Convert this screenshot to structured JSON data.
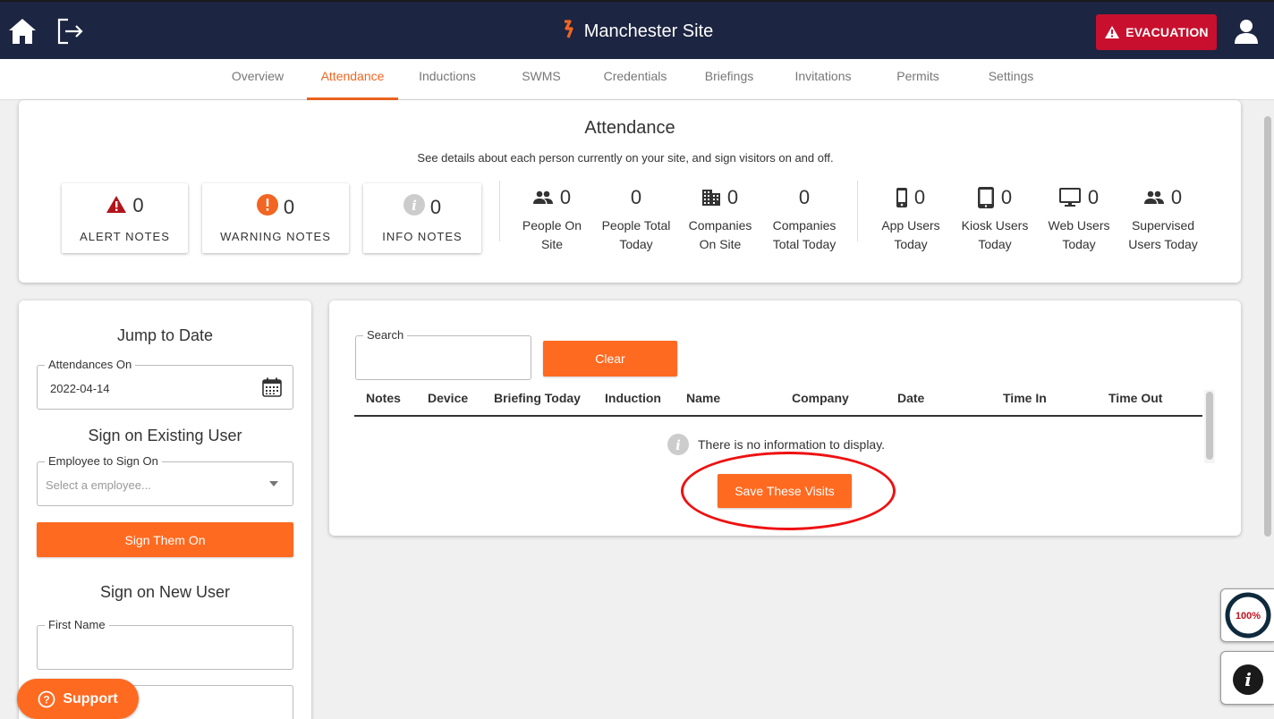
{
  "header": {
    "site_title": "Manchester Site",
    "evacuation_label": "EVACUATION"
  },
  "tabs": [
    {
      "label": "Overview",
      "active": false
    },
    {
      "label": "Attendance",
      "active": true
    },
    {
      "label": "Inductions",
      "active": false
    },
    {
      "label": "SWMS",
      "active": false
    },
    {
      "label": "Credentials",
      "active": false
    },
    {
      "label": "Briefings",
      "active": false
    },
    {
      "label": "Invitations",
      "active": false
    },
    {
      "label": "Permits",
      "active": false
    },
    {
      "label": "Settings",
      "active": false
    }
  ],
  "summary": {
    "title": "Attendance",
    "subtitle": "See details about each person currently on your site, and sign visitors on and off.",
    "notes": [
      {
        "label": "ALERT NOTES",
        "value": "0",
        "icon": "alert-triangle-icon"
      },
      {
        "label": "WARNING NOTES",
        "value": "0",
        "icon": "exclamation-circle-icon"
      },
      {
        "label": "INFO NOTES",
        "value": "0",
        "icon": "info-circle-icon"
      }
    ],
    "stats": [
      {
        "label_1": "People On",
        "label_2": "Site",
        "value": "0",
        "icon": "people-icon"
      },
      {
        "label_1": "People Total",
        "label_2": "Today",
        "value": "0",
        "icon": ""
      },
      {
        "label_1": "Companies",
        "label_2": "On Site",
        "value": "0",
        "icon": "building-icon"
      },
      {
        "label_1": "Companies",
        "label_2": "Total Today",
        "value": "0",
        "icon": ""
      },
      {
        "label_1": "App Users",
        "label_2": "Today",
        "value": "0",
        "icon": "mobile-icon"
      },
      {
        "label_1": "Kiosk Users",
        "label_2": "Today",
        "value": "0",
        "icon": "tablet-icon"
      },
      {
        "label_1": "Web Users",
        "label_2": "Today",
        "value": "0",
        "icon": "monitor-icon"
      },
      {
        "label_1": "Supervised",
        "label_2": "Users Today",
        "value": "0",
        "icon": "people-icon"
      }
    ]
  },
  "left_panel": {
    "jump_heading": "Jump to Date",
    "attendances_label": "Attendances On",
    "attendances_value": "2022-04-14",
    "existing_heading": "Sign on Existing User",
    "employee_label": "Employee to Sign On",
    "employee_placeholder": "Select a employee...",
    "sign_on_button": "Sign Them On",
    "new_heading": "Sign on New User",
    "first_name_label": "First Name"
  },
  "right_panel": {
    "search_label": "Search",
    "clear_button": "Clear",
    "columns": [
      "Notes",
      "Device",
      "Briefing Today",
      "Induction",
      "Name",
      "Company",
      "Date",
      "Time In",
      "Time Out"
    ],
    "empty_message": "There is no information to display.",
    "save_button": "Save These Visits"
  },
  "floating": {
    "support_label": "Support",
    "progress_label": "100%"
  },
  "colors": {
    "navbar": "#1c2541",
    "accent": "#ff6a21",
    "evacuation": "#c8102e",
    "highlight": "#ee1111"
  }
}
